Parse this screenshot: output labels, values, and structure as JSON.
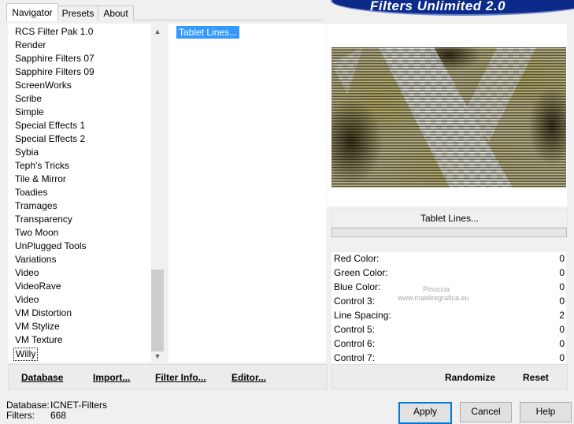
{
  "banner": {
    "title": "Filters Unlimited 2.0"
  },
  "tabs": [
    "Navigator",
    "Presets",
    "About"
  ],
  "categories": [
    "RCS Filter Pak 1.0",
    "Render",
    "Sapphire Filters 07",
    "Sapphire Filters 09",
    "ScreenWorks",
    "Scribe",
    "Simple",
    "Special Effects 1",
    "Special Effects 2",
    "Sybia",
    "Teph's Tricks",
    "Tile & Mirror",
    "Toadies",
    "Tramages",
    "Transparency",
    "Two Moon",
    "UnPlugged Tools",
    "Variations",
    "Video",
    "VideoRave",
    "Video",
    "VM Distortion",
    "VM Stylize",
    "VM Texture",
    "Willy"
  ],
  "selected_category": "Willy",
  "filters": [
    "Tablet Lines..."
  ],
  "left_buttons": {
    "database": "Database",
    "import": "Import...",
    "filter_info": "Filter Info...",
    "editor": "Editor..."
  },
  "filter_name": "Tablet Lines...",
  "controls": [
    {
      "label": "Red Color:",
      "value": "0"
    },
    {
      "label": "Green Color:",
      "value": "0"
    },
    {
      "label": "Blue Color:",
      "value": "0"
    },
    {
      "label": "Control 3:",
      "value": "0"
    },
    {
      "label": "Line Spacing:",
      "value": "2"
    },
    {
      "label": "Control 5:",
      "value": "0"
    },
    {
      "label": "Control 6:",
      "value": "0"
    },
    {
      "label": "Control 7:",
      "value": "0"
    }
  ],
  "right_buttons": {
    "randomize": "Randomize",
    "reset": "Reset"
  },
  "status": {
    "database_label": "Database:",
    "database_value": "ICNET-Filters",
    "filters_label": "Filters:",
    "filters_value": "668"
  },
  "dialog_buttons": {
    "apply": "Apply",
    "cancel": "Cancel",
    "help": "Help"
  },
  "watermark": {
    "line1": "Pinuccia",
    "line2": "www.maidiregrafica.eu"
  }
}
